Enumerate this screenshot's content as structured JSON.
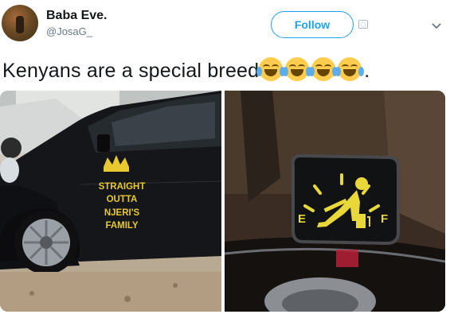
{
  "user": {
    "name": "Baba Eve.",
    "handle": "@JosaG_"
  },
  "follow_button": {
    "label": "Follow"
  },
  "tweet": {
    "text": "Kenyans are a special breed",
    "suffix": "."
  },
  "emojis": [
    "face-with-tears-of-joy",
    "face-with-tears-of-joy",
    "face-with-tears-of-joy",
    "face-with-tears-of-joy"
  ],
  "images": [
    {
      "sticker_lines": [
        "STRAIGHT",
        "OUTTA",
        "NJERI'S",
        "FAMILY"
      ]
    },
    {
      "gauge_labels": {
        "empty": "E",
        "full": "F"
      }
    }
  ],
  "colors": {
    "accent": "#1da1f2",
    "sticker_yellow": "#e8c930"
  }
}
